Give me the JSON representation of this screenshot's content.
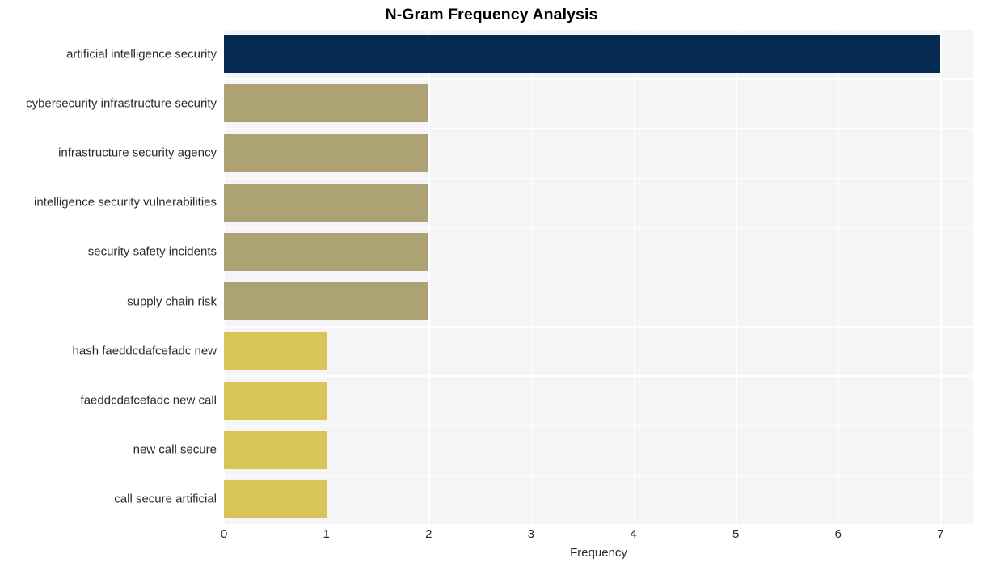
{
  "chart_data": {
    "type": "bar",
    "orientation": "horizontal",
    "title": "N-Gram Frequency Analysis",
    "xlabel": "Frequency",
    "ylabel": "",
    "categories": [
      "artificial intelligence security",
      "cybersecurity infrastructure security",
      "infrastructure security agency",
      "intelligence security vulnerabilities",
      "security safety incidents",
      "supply chain risk",
      "hash faeddcdafcefadc new",
      "faeddcdafcefadc new call",
      "new call secure",
      "call secure artificial"
    ],
    "values": [
      7,
      2,
      2,
      2,
      2,
      2,
      1,
      1,
      1,
      1
    ],
    "bar_colors": [
      "#042a52",
      "#aca273",
      "#aca273",
      "#aca273",
      "#aca273",
      "#aca273",
      "#d8c557",
      "#d8c557",
      "#d8c557",
      "#d8c557"
    ],
    "xlim": [
      0,
      7.32
    ],
    "xticks": [
      0,
      1,
      2,
      3,
      4,
      5,
      6,
      7
    ],
    "xticklabels": [
      "0",
      "1",
      "2",
      "3",
      "4",
      "5",
      "6",
      "7"
    ],
    "grid": true,
    "grid_color": "#ffffff",
    "plot_background": "#f5f5f7",
    "figure_background": "#ffffff",
    "legend": null
  },
  "style": {
    "title_color": "#000000",
    "tick_color": "#2b2b2b"
  }
}
